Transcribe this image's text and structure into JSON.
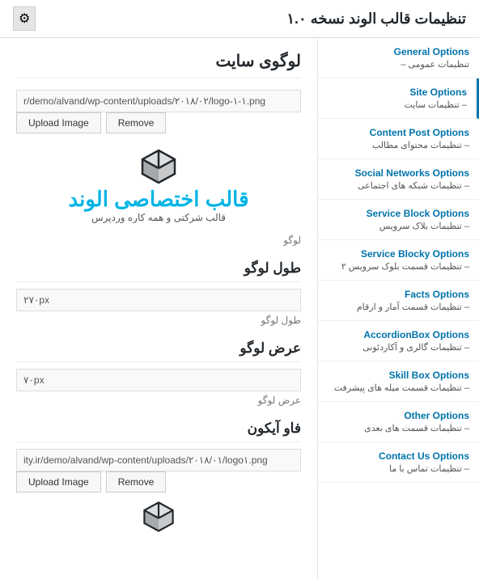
{
  "header": {
    "title": "تنظیمات قالب الوند نسخه ۱.۰",
    "settings_icon": "⚙"
  },
  "sidebar": {
    "items": [
      {
        "id": "general",
        "title": "General Options",
        "subtitle": "تنظیمات عمومی –",
        "active": false
      },
      {
        "id": "site",
        "title": "Site Options",
        "subtitle": "– تنظیمات سایت",
        "active": true
      },
      {
        "id": "content-post",
        "title": "Content Post Options",
        "subtitle": "– تنظیمات محتوای مطالب",
        "active": false
      },
      {
        "id": "social-networks",
        "title": "Social Networks Options",
        "subtitle": "– تنظیمات شبکه های اجتماعی",
        "active": false
      },
      {
        "id": "service-block",
        "title": "Service Block Options",
        "subtitle": "– تنظیمات بلاک سرویس",
        "active": false
      },
      {
        "id": "service-block2",
        "title": "Service Blocky Options",
        "subtitle": "– تنظیمات قسمت بلوک سرویس ۲",
        "active": false
      },
      {
        "id": "facts",
        "title": "Facts Options",
        "subtitle": "– تنظیمات قسمت آمار و ارقام",
        "active": false
      },
      {
        "id": "accordion",
        "title": "AccordionBox Options",
        "subtitle": "– تنظیمات گالری و آکاردئونی",
        "active": false
      },
      {
        "id": "skill-box",
        "title": "Skill Box Options",
        "subtitle": "– تنظیمات قسمت میله های پیشرفت",
        "active": false
      },
      {
        "id": "other",
        "title": "Other Options",
        "subtitle": "– تنظیمات قسمت های بعدی",
        "active": false
      },
      {
        "id": "contact",
        "title": "Contact Us Options",
        "subtitle": "– تنظیمات تماس با ما",
        "active": false
      }
    ]
  },
  "main": {
    "section_title": "لوگوی سایت",
    "logo_path_label": "r/demo/alvand/wp-content/uploads/۲۰۱۸/۰۲/logo-۱-۱.png",
    "logo_path_placeholder": "r/demo/alvand/wp-content/uploads/۲۰۱۸/۰۲/logo-۱-۱.png",
    "btn_remove": "Remove",
    "btn_upload": "Upload Image",
    "logo_main_text": "قالب اختصاصی الوند",
    "logo_subtitle_text": "قالب شرکتی و همه کاره وردپرس",
    "logo_field_label": "لوگو",
    "logo_width_title": "طول لوگو",
    "logo_width_value": "۲۷۰px",
    "logo_width_label": "طول لوگو",
    "logo_height_title": "عرض لوگو",
    "logo_height_value": "۷۰px",
    "logo_height_label": "عرض لوگو",
    "favicon_title": "فاو آیکون",
    "favicon_path": "ity.ir/demo/alvand/wp-content/uploads/۲۰۱۸/۰۱/logo۱.png",
    "favicon_label": "",
    "btn_remove2": "Remove",
    "btn_upload2": "Upload Image"
  }
}
